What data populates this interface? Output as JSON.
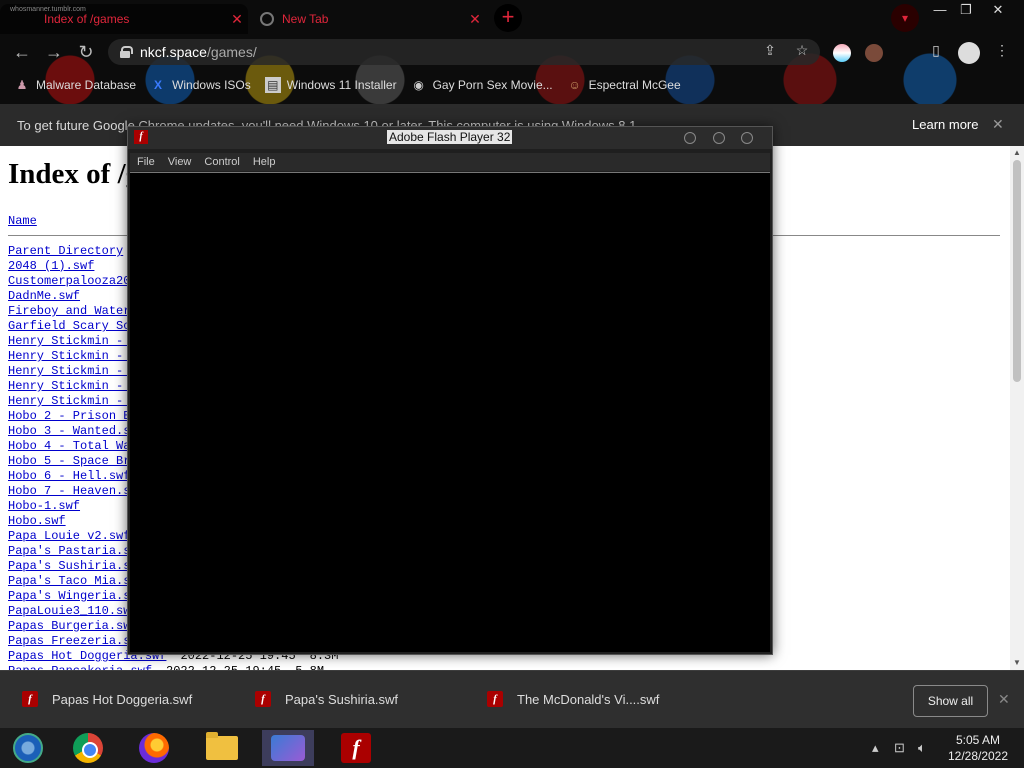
{
  "browser": {
    "tabs": [
      {
        "title": "Index of /games",
        "active": true,
        "subtitle": "whosmanner.tumblr.com"
      },
      {
        "title": "New Tab",
        "active": false
      }
    ],
    "new_tab_symbol": "+",
    "omnibox": {
      "host": "nkcf.space",
      "path": "/games/"
    },
    "bookmarks": [
      {
        "label": "Malware Database",
        "icon": "malware-icon"
      },
      {
        "label": "Windows ISOs",
        "icon": "x-icon"
      },
      {
        "label": "Windows 11 Installer",
        "icon": "page-icon"
      },
      {
        "label": "Gay Porn Sex Movie...",
        "icon": "site-icon"
      },
      {
        "label": "Espectral McGee",
        "icon": "avatar-icon"
      }
    ]
  },
  "infobar": {
    "message": "To get future Google Chrome updates, you'll need Windows 10 or later. This computer is using Windows 8.1.",
    "learn_more": "Learn more"
  },
  "page": {
    "heading": "Index of /games",
    "column_name": "Name",
    "files": [
      {
        "name": "Parent Directory"
      },
      {
        "name": "2048 (1).swf"
      },
      {
        "name": "Customerpalooza2022.swf"
      },
      {
        "name": "DadnMe.swf"
      },
      {
        "name": "Fireboy and Watergirl.swf"
      },
      {
        "name": "Garfield Scary Scavenger Hunt.swf"
      },
      {
        "name": "Henry Stickmin - Breaking the Bank.swf"
      },
      {
        "name": "Henry Stickmin - Escaping the Prison.swf"
      },
      {
        "name": "Henry Stickmin - Stealing the Diamond.swf"
      },
      {
        "name": "Henry Stickmin - Infiltrating the Airship.swf"
      },
      {
        "name": "Henry Stickmin - Fleeing the Complex.swf"
      },
      {
        "name": "Hobo 2 - Prison Brawl.swf"
      },
      {
        "name": "Hobo 3 - Wanted.swf"
      },
      {
        "name": "Hobo 4 - Total War.swf"
      },
      {
        "name": "Hobo 5 - Space Brawls.swf"
      },
      {
        "name": "Hobo 6 - Hell.swf"
      },
      {
        "name": "Hobo 7 - Heaven.swf"
      },
      {
        "name": "Hobo-1.swf"
      },
      {
        "name": "Hobo.swf"
      },
      {
        "name": "Papa Louie v2.swf"
      },
      {
        "name": "Papa's Pastaria.swf"
      },
      {
        "name": "Papa's Sushiria.swf"
      },
      {
        "name": "Papa's Taco Mia.swf"
      },
      {
        "name": "Papa's Wingeria.swf"
      },
      {
        "name": "PapaLouie3_110.swf"
      },
      {
        "name": "Papas Burgeria.swf"
      },
      {
        "name": "Papas Freezeria.swf"
      },
      {
        "name": "Papas Hot Doggeria.swf",
        "date": "2022-12-25 19:45",
        "size": "8.3M"
      },
      {
        "name": "Papas Pancakeria.swf",
        "date": "2022-12-25 19:45",
        "size": "5.8M"
      }
    ]
  },
  "flash_window": {
    "title": "Adobe Flash Player 32",
    "menus": [
      "File",
      "View",
      "Control",
      "Help"
    ]
  },
  "downloads": {
    "items": [
      "Papas Hot Doggeria.swf",
      "Papa's Sushiria.swf",
      "The McDonald's Vi....swf"
    ],
    "show_all": "Show all"
  },
  "taskbar": {
    "time": "5:05 AM",
    "date": "12/28/2022"
  },
  "colors": {
    "tab_accent": "#e0263b",
    "link": "#0000cc",
    "flash_red": "#aa0000"
  }
}
